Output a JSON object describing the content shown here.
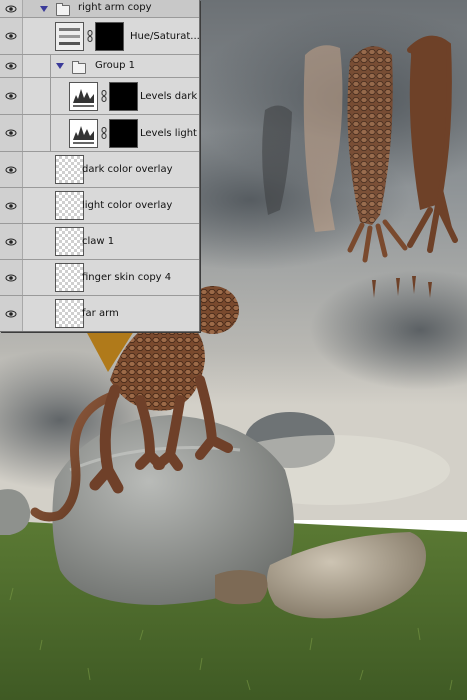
{
  "layers_panel": {
    "layers": [
      {
        "name": "right arm copy",
        "type": "group",
        "expanded": true,
        "indent": 0
      },
      {
        "name": "Hue/Saturat...",
        "type": "adjustment",
        "indent": 1,
        "has_mask": true
      },
      {
        "name": "Group 1",
        "type": "group",
        "expanded": true,
        "indent": 1
      },
      {
        "name": "Levels dark",
        "type": "adjustment",
        "indent": 2,
        "has_mask": true
      },
      {
        "name": "Levels light",
        "type": "adjustment",
        "indent": 2,
        "has_mask": true
      },
      {
        "name": "dark color overlay",
        "type": "pixel",
        "indent": 1
      },
      {
        "name": "light color overlay",
        "type": "pixel",
        "indent": 1
      },
      {
        "name": "claw 1",
        "type": "pixel",
        "indent": 1
      },
      {
        "name": "finger skin copy 4",
        "type": "pixel",
        "indent": 1
      },
      {
        "name": "far arm",
        "type": "pixel",
        "indent": 1
      }
    ]
  },
  "colors": {
    "panel_bg": "#d6d6d6",
    "sky": "#9ea3a6",
    "grass": "#4f6b2c",
    "rock": "#9a9c99",
    "creature": "#7a4a2e"
  },
  "icons": {
    "visibility": "eye-icon",
    "group": "folder-icon",
    "expand": "triangle-down-icon",
    "link": "chain-link-icon"
  }
}
